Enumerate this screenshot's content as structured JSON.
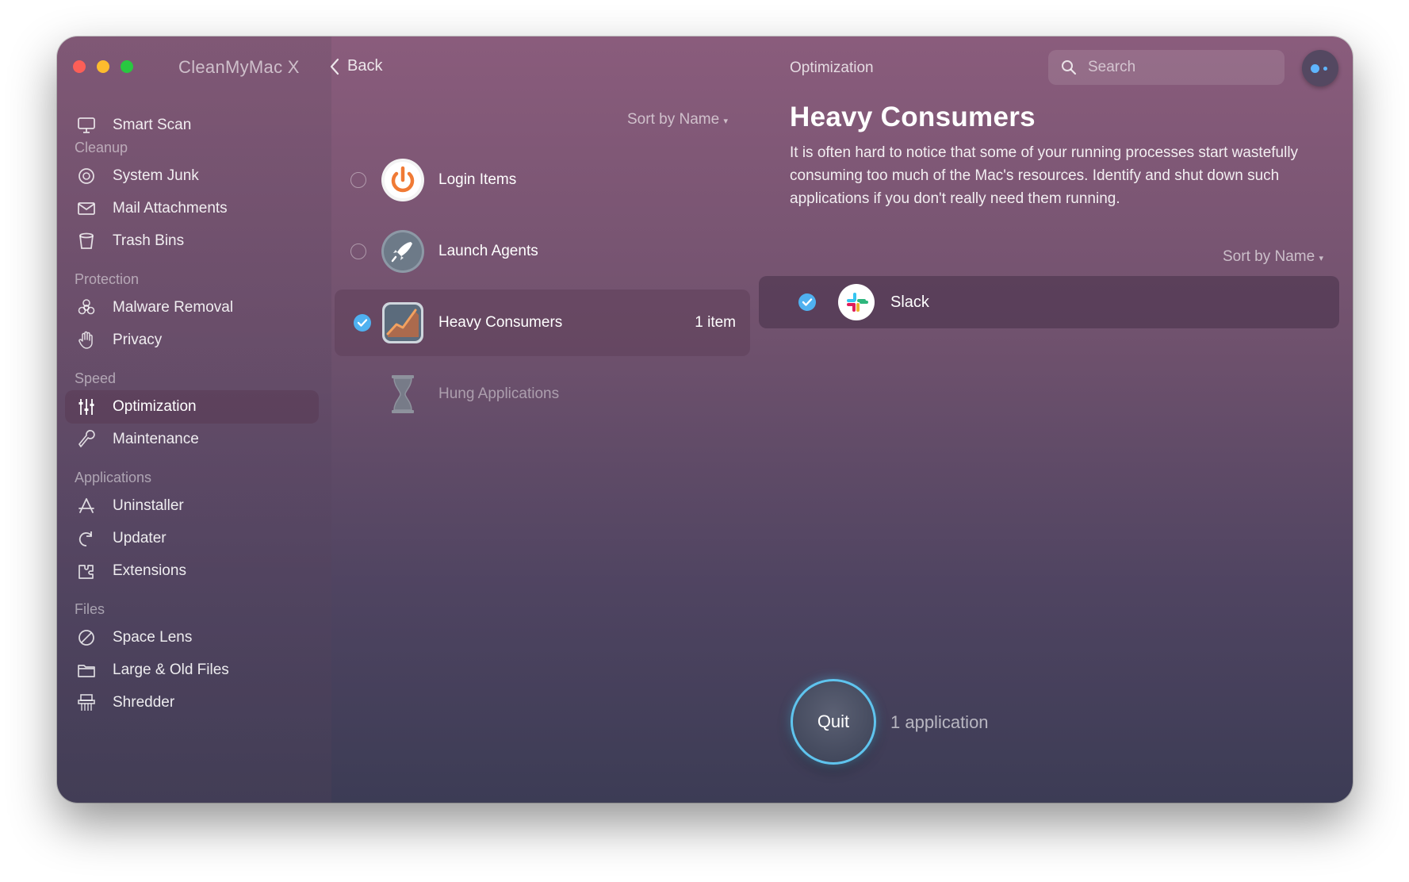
{
  "window": {
    "app_title": "CleanMyMac X",
    "back_label": "Back",
    "header_title": "Optimization"
  },
  "search": {
    "placeholder": "Search"
  },
  "sidebar": {
    "smart_scan": "Smart Scan",
    "sections": {
      "cleanup": "Cleanup",
      "protection": "Protection",
      "speed": "Speed",
      "applications": "Applications",
      "files": "Files"
    },
    "items": {
      "system_junk": "System Junk",
      "mail_attachments": "Mail Attachments",
      "trash_bins": "Trash Bins",
      "malware_removal": "Malware Removal",
      "privacy": "Privacy",
      "optimization": "Optimization",
      "maintenance": "Maintenance",
      "uninstaller": "Uninstaller",
      "updater": "Updater",
      "extensions": "Extensions",
      "space_lens": "Space Lens",
      "large_old_files": "Large & Old Files",
      "shredder": "Shredder"
    },
    "active_item": "optimization"
  },
  "middle": {
    "sort_label": "Sort by Name",
    "items": [
      {
        "label": "Login Items",
        "icon": "power-icon",
        "checked": false
      },
      {
        "label": "Launch Agents",
        "icon": "rocket-icon",
        "checked": false
      },
      {
        "label": "Heavy Consumers",
        "icon": "chart-icon",
        "checked": true,
        "count": "1 item"
      },
      {
        "label": "Hung Applications",
        "icon": "hourglass-icon",
        "disabled": true
      }
    ]
  },
  "detail": {
    "title": "Heavy Consumers",
    "description": "It is often hard to notice that some of your running processes start wastefully consuming too much of the Mac's resources. Identify and shut down such applications if you don't really need them running.",
    "sort_label": "Sort by Name",
    "apps": [
      {
        "name": "Slack",
        "checked": true,
        "icon": "slack-icon"
      }
    ]
  },
  "action": {
    "quit_label": "Quit",
    "summary": "1 application"
  },
  "colors": {
    "accent": "#4fb1f0",
    "quit_ring": "#5fc4ee"
  }
}
